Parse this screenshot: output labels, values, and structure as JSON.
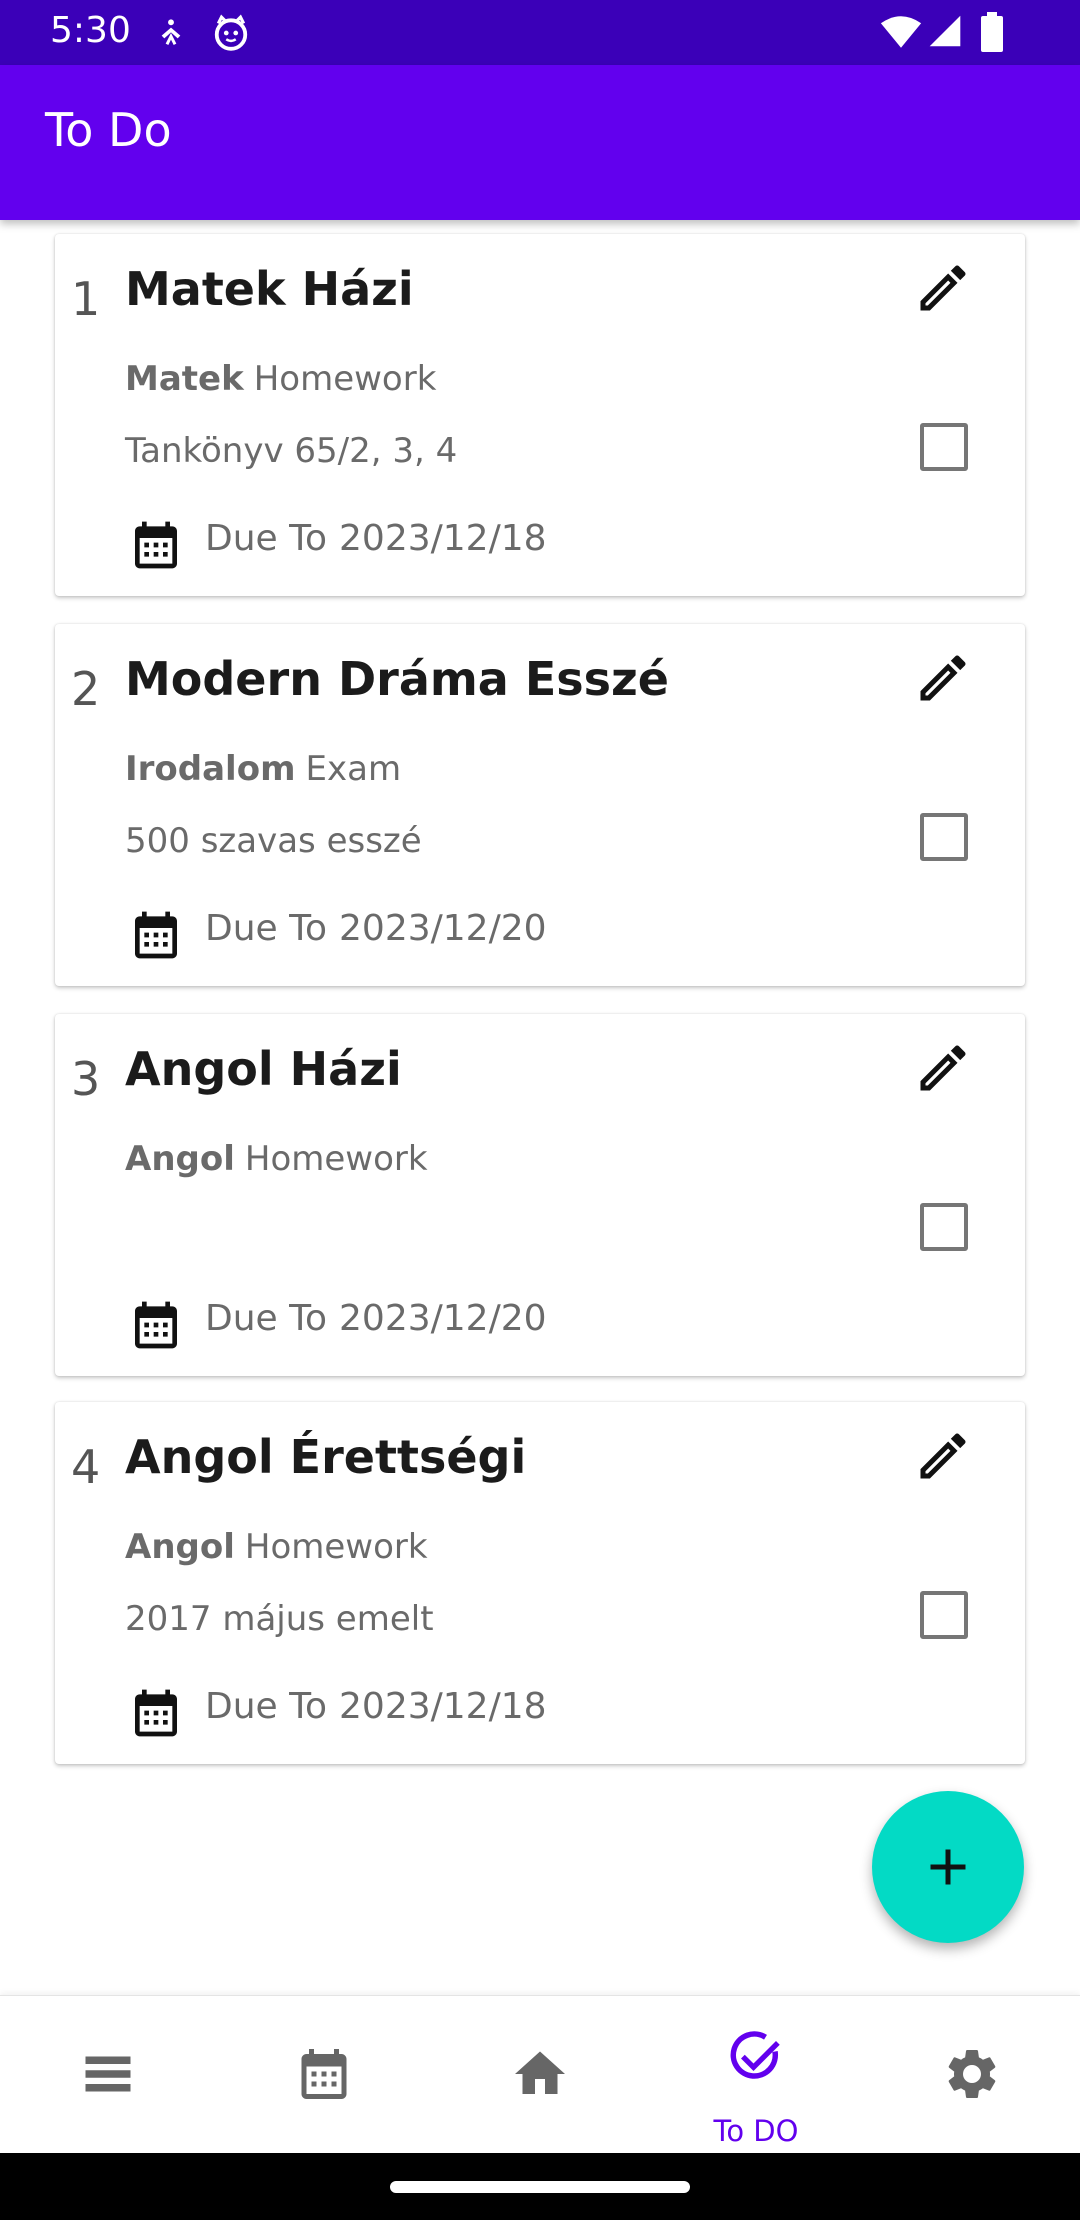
{
  "status_bar": {
    "time": "5:30",
    "icons": [
      "accessibility-icon",
      "android-cat-icon",
      "wifi-icon",
      "cell-signal-icon",
      "battery-icon"
    ],
    "background": "#3b00b8"
  },
  "app_bar": {
    "title": "To Do",
    "background": "#6200ee"
  },
  "todos": [
    {
      "number": "1",
      "title": "Matek Házi",
      "subject": "Matek",
      "type": "Homework",
      "description": "Tankönyv 65/2, 3, 4",
      "due_label": "Due To",
      "due_date": "2023/12/18",
      "checked": false
    },
    {
      "number": "2",
      "title": "Modern Dráma Esszé",
      "subject": "Irodalom",
      "type": "Exam",
      "description": "500 szavas esszé",
      "due_label": "Due To",
      "due_date": "2023/12/20",
      "checked": false
    },
    {
      "number": "3",
      "title": "Angol Házi",
      "subject": "Angol",
      "type": "Homework",
      "description": "",
      "due_label": "Due To",
      "due_date": "2023/12/20",
      "checked": false
    },
    {
      "number": "4",
      "title": "Angol Érettségi",
      "subject": "Angol",
      "type": "Homework",
      "description": "2017 május emelt",
      "due_label": "Due To",
      "due_date": "2023/12/18",
      "checked": false
    }
  ],
  "fab": {
    "icon": "plus-icon",
    "color": "#03dac5"
  },
  "bottom_nav": {
    "items": [
      {
        "icon": "menu-icon",
        "label": ""
      },
      {
        "icon": "calendar-icon",
        "label": ""
      },
      {
        "icon": "home-icon",
        "label": ""
      },
      {
        "icon": "check-circle-icon",
        "label": "To DO",
        "active": true
      },
      {
        "icon": "gear-icon",
        "label": ""
      }
    ],
    "active_color": "#6200ee",
    "inactive_color": "#666666"
  }
}
